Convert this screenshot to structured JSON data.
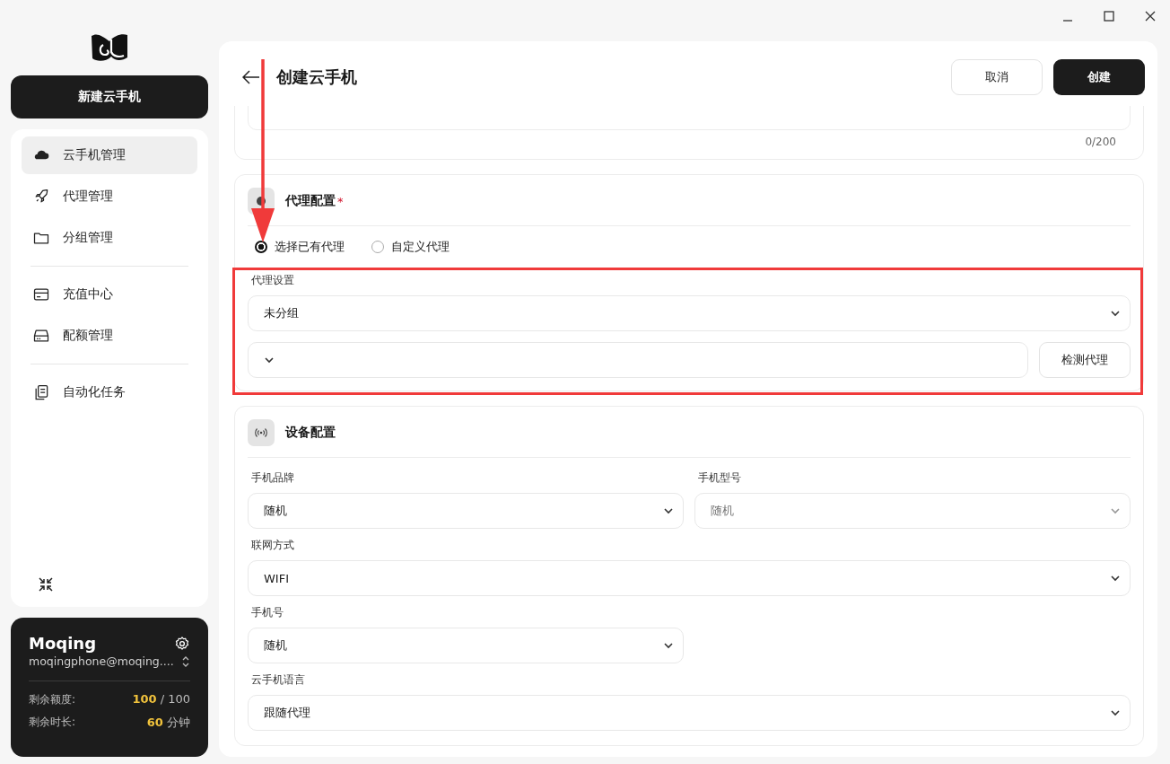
{
  "sidebar": {
    "new_button": "新建云手机",
    "nav_groups": [
      [
        {
          "label": "云手机管理",
          "selected": true
        },
        {
          "label": "代理管理",
          "selected": false
        },
        {
          "label": "分组管理",
          "selected": false
        }
      ],
      [
        {
          "label": "充值中心",
          "selected": false
        },
        {
          "label": "配额管理",
          "selected": false
        }
      ],
      [
        {
          "label": "自动化任务",
          "selected": false
        }
      ]
    ]
  },
  "account": {
    "name": "Moqing",
    "email": "moqingphone@moqing....",
    "stats": [
      {
        "label": "剩余额度:",
        "value": "100",
        "unit": "/ 100"
      },
      {
        "label": "剩余时长:",
        "value": "60",
        "unit": "分钟"
      }
    ]
  },
  "page": {
    "title": "创建云手机",
    "buttons": [
      {
        "label": "取消",
        "kind": "secondary"
      },
      {
        "label": "创建",
        "kind": "primary"
      }
    ]
  },
  "description": {
    "counter": "0/200"
  },
  "proxy_section": {
    "title": "代理配置",
    "required_mark": "*",
    "options": [
      {
        "label": "选择已有代理",
        "selected": true
      },
      {
        "label": "自定义代理",
        "selected": false
      }
    ],
    "field_label": "代理设置",
    "group_select": "未分组",
    "check_button": "检测代理"
  },
  "device_section": {
    "title": "设备配置",
    "fields": [
      {
        "label": "手机品牌",
        "value": "随机",
        "wide": false,
        "disabled": false
      },
      {
        "label": "手机型号",
        "value": "随机",
        "wide": false,
        "disabled": true
      },
      {
        "label": "联网方式",
        "value": "WIFI",
        "wide": true,
        "disabled": false
      },
      {
        "label": "手机号",
        "value": "随机",
        "wide": false,
        "disabled": false
      },
      {
        "label": "云手机语言",
        "value": "跟随代理",
        "wide": true,
        "disabled": false
      }
    ]
  }
}
